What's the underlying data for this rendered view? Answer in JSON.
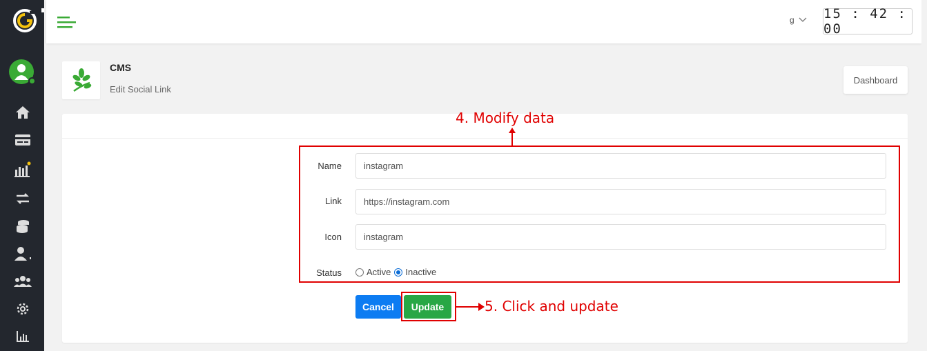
{
  "topbar": {
    "language": "g",
    "clock": "15 : 42 : 00"
  },
  "page": {
    "title": "CMS",
    "subtitle": "Edit Social Link",
    "dashboard_button": "Dashboard"
  },
  "form": {
    "name_label": "Name",
    "name_value": "instagram",
    "link_label": "Link",
    "link_value": "https://instagram.com",
    "icon_label": "Icon",
    "icon_value": "instagram",
    "status_label": "Status",
    "status_options": [
      "Active",
      "Inactive"
    ],
    "status_selected": "Inactive",
    "cancel_button": "Cancel",
    "update_button": "Update"
  },
  "annotations": {
    "step4": "4. Modify data",
    "step5": "5. Click and update",
    "color": "#e00000"
  },
  "colors": {
    "sidebar": "#23272e",
    "accent_green": "#28a745",
    "primary_blue": "#0d7cf2"
  },
  "sidebar": {
    "icons": [
      "home-icon",
      "card-icon",
      "chart-icon",
      "transfer-icon",
      "coins-icon",
      "user-tie-icon",
      "users-icon",
      "gear-icon",
      "bar-chart-icon"
    ]
  }
}
